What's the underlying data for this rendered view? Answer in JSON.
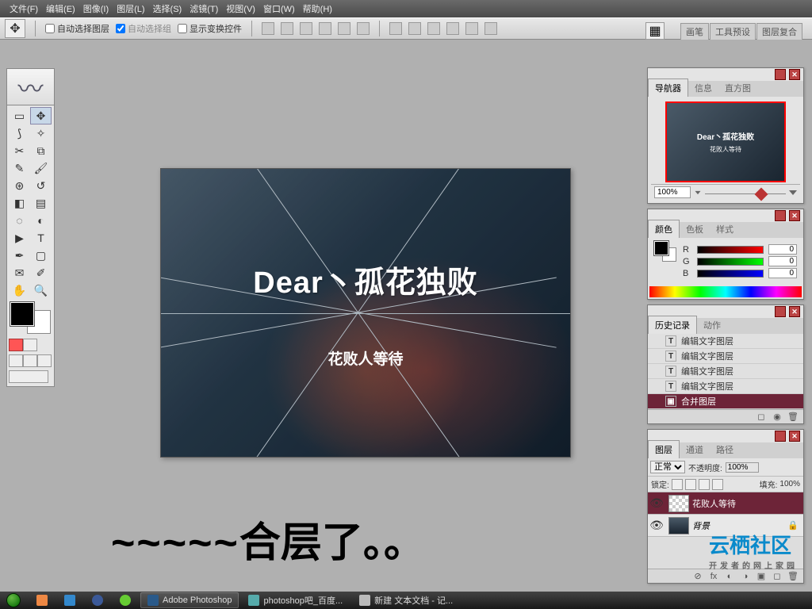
{
  "menu": [
    "文件(F)",
    "编辑(E)",
    "图像(I)",
    "图层(L)",
    "选择(S)",
    "滤镜(T)",
    "视图(V)",
    "窗口(W)",
    "帮助(H)"
  ],
  "options": {
    "auto_select_layer": "自动选择图层",
    "auto_select_group": "自动选择组",
    "show_transform": "显示变换控件"
  },
  "side_tabs": [
    "画笔",
    "工具预设",
    "图层复合"
  ],
  "doc": {
    "title": "Dear丶孤花独败",
    "subtitle": "花败人等待"
  },
  "note": {
    "wave": "~~~~~",
    "text": "合层了。。"
  },
  "navigator": {
    "tabs": [
      "导航器",
      "信息",
      "直方图"
    ],
    "zoom": "100%",
    "thumb_t1": "Dear丶孤花独败",
    "thumb_t2": "花败人等待"
  },
  "color_panel": {
    "tabs": [
      "颜色",
      "色板",
      "样式"
    ],
    "r": "0",
    "g": "0",
    "b": "0"
  },
  "history": {
    "tabs": [
      "历史记录",
      "动作"
    ],
    "items": [
      {
        "icon": "T",
        "label": "编辑文字图层"
      },
      {
        "icon": "T",
        "label": "编辑文字图层"
      },
      {
        "icon": "T",
        "label": "编辑文字图层"
      },
      {
        "icon": "T",
        "label": "编辑文字图层"
      }
    ],
    "selected": {
      "icon": "▣",
      "label": "合并图层"
    }
  },
  "layers": {
    "tabs": [
      "图层",
      "通道",
      "路径"
    ],
    "blend": "正常",
    "opacity_label": "不透明度:",
    "opacity": "100%",
    "lock_label": "锁定:",
    "fill_label": "填充:",
    "fill": "100%",
    "rows": [
      {
        "name": "花败人等待",
        "selected": true,
        "thumb": "tr"
      },
      {
        "name": "背景",
        "selected": false,
        "thumb": "img",
        "lock": true
      }
    ]
  },
  "taskbar": {
    "apps": [
      {
        "label": "Adobe Photoshop",
        "active": true
      },
      {
        "label": "photoshop吧_百度...",
        "active": false
      },
      {
        "label": "新建 文本文档 - 记...",
        "active": false
      }
    ]
  },
  "watermark": {
    "main": "云栖社区",
    "sub": "开发者的网上家园"
  }
}
